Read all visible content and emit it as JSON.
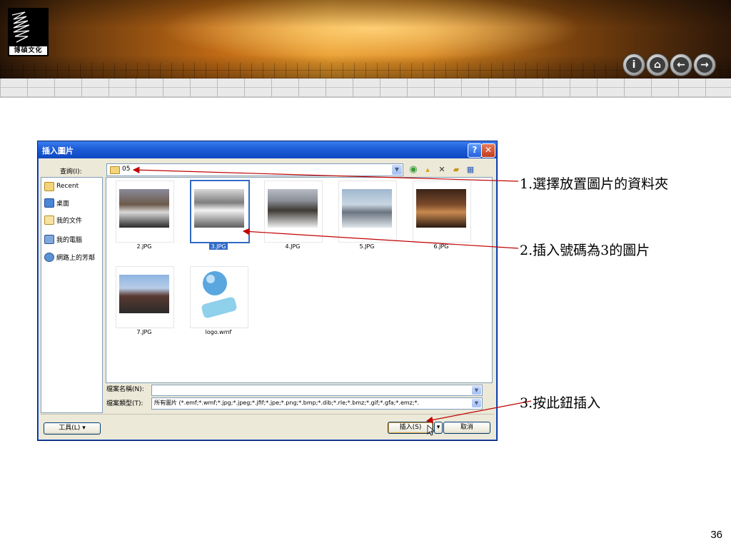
{
  "header": {
    "logo_text": "博碩文化",
    "nav_buttons": [
      {
        "icon": "info-icon",
        "glyph": "i"
      },
      {
        "icon": "home-icon",
        "glyph": "⌂"
      },
      {
        "icon": "arrow-left-icon",
        "glyph": "←"
      },
      {
        "icon": "arrow-right-icon",
        "glyph": "→"
      }
    ]
  },
  "dialog": {
    "title": "插入圖片",
    "help_label": "?",
    "close_label": "✕",
    "look_in_label": "查詢(I):",
    "look_in_value": "05",
    "places": [
      {
        "label": "Recent",
        "icon": "recent-folder-icon"
      },
      {
        "label": "桌面",
        "icon": "desktop-icon"
      },
      {
        "label": "我的文件",
        "icon": "my-documents-icon"
      },
      {
        "label": "我的電腦",
        "icon": "my-computer-icon"
      },
      {
        "label": "網路上的芳鄰",
        "icon": "network-places-icon"
      }
    ],
    "files": [
      {
        "name": "2.JPG"
      },
      {
        "name": "3.JPG",
        "selected": true
      },
      {
        "name": "4.JPG"
      },
      {
        "name": "5.JPG"
      },
      {
        "name": "6.JPG"
      },
      {
        "name": "7.JPG"
      },
      {
        "name": "logo.wmf"
      }
    ],
    "file_name_label": "檔案名稱(N):",
    "file_name_value": "",
    "file_type_label": "檔案類型(T):",
    "file_type_value": "所有圖片 (*.emf;*.wmf;*.jpg;*.jpeg;*.jfif;*.jpe;*.png;*.bmp;*.dib;*.rle;*.bmz;*.gif;*.gfa;*.emz;*.",
    "tools_label": "工具(L)",
    "insert_label": "插入(S)",
    "cancel_label": "取消"
  },
  "annotations": {
    "step1": "1.選擇放置圖片的資料夾",
    "step2": "2.插入號碼為3的圖片",
    "step3": "3.按此鈕插入"
  },
  "page_number": "36",
  "colors": {
    "arrow": "#c00000",
    "selection": "#316ac5",
    "titlebar": "#1f5fd9"
  }
}
